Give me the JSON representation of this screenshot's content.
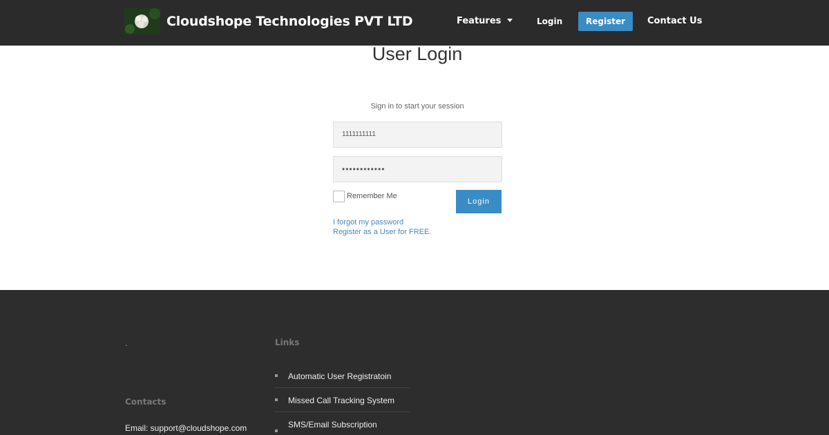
{
  "header": {
    "brand": "Cloudshope Technologies PVT LTD",
    "nav": {
      "features": "Features",
      "login": "Login",
      "register": "Register",
      "contact": "Contact Us"
    }
  },
  "login": {
    "title": "User Login",
    "subtitle": "Sign in to start your session",
    "username_value": "1111111111",
    "password_value": "••••••••••••",
    "remember_label": "Remember Me",
    "login_button": "Login",
    "forgot_link": "I forgot my password",
    "register_link": "Register as a User for FREE."
  },
  "footer": {
    "dot": ".",
    "links_heading": "Links",
    "links": [
      "Automatic User Registratoin",
      "Missed Call Tracking System",
      "SMS/Email Subscription"
    ],
    "contacts_heading": "Contacts",
    "email": "Email: support@cloudshope.com"
  },
  "colors": {
    "header_bg": "#2b2b2b",
    "accent": "#3a8cc4",
    "footer_bg": "#2d2d2d",
    "link": "#4a86b8"
  }
}
